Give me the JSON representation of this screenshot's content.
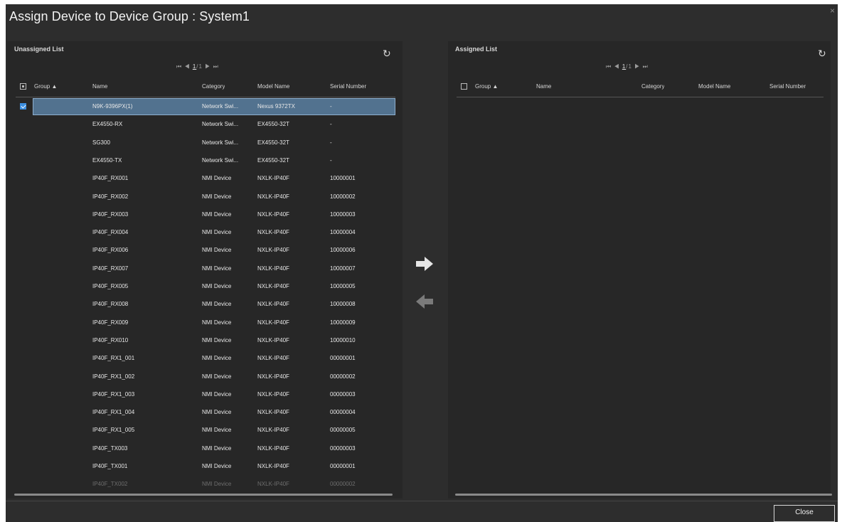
{
  "window": {
    "title": "Assign Device to Device Group : System1",
    "close_glyph": "×"
  },
  "unassigned": {
    "label": "Unassigned List",
    "refresh_icon": "↻",
    "pager": {
      "first": "⏮",
      "prev": "◀",
      "page": "1",
      "sep": "/",
      "total": "1",
      "next": "▶",
      "last": "⏭"
    },
    "headers": {
      "group": "Group",
      "sort_indicator": "▲",
      "name": "Name",
      "category": "Category",
      "model": "Model Name",
      "serial": "Serial Number"
    },
    "rows": [
      {
        "name": "N9K-9396PX(1)",
        "category": "Network Swi...",
        "model": "Nexus 9372TX",
        "serial": "-",
        "selected": true
      },
      {
        "name": "EX4550-RX",
        "category": "Network Swi...",
        "model": "EX4550-32T",
        "serial": "-"
      },
      {
        "name": "SG300",
        "category": "Network Swi...",
        "model": "EX4550-32T",
        "serial": "-"
      },
      {
        "name": "EX4550-TX",
        "category": "Network Swi...",
        "model": "EX4550-32T",
        "serial": "-"
      },
      {
        "name": "IP40F_RX001",
        "category": "NMI Device",
        "model": "NXLK-IP40F",
        "serial": "10000001"
      },
      {
        "name": "IP40F_RX002",
        "category": "NMI Device",
        "model": "NXLK-IP40F",
        "serial": "10000002"
      },
      {
        "name": "IP40F_RX003",
        "category": "NMI Device",
        "model": "NXLK-IP40F",
        "serial": "10000003"
      },
      {
        "name": "IP40F_RX004",
        "category": "NMI Device",
        "model": "NXLK-IP40F",
        "serial": "10000004"
      },
      {
        "name": "IP40F_RX006",
        "category": "NMI Device",
        "model": "NXLK-IP40F",
        "serial": "10000006"
      },
      {
        "name": "IP40F_RX007",
        "category": "NMI Device",
        "model": "NXLK-IP40F",
        "serial": "10000007"
      },
      {
        "name": "IP40F_RX005",
        "category": "NMI Device",
        "model": "NXLK-IP40F",
        "serial": "10000005"
      },
      {
        "name": "IP40F_RX008",
        "category": "NMI Device",
        "model": "NXLK-IP40F",
        "serial": "10000008"
      },
      {
        "name": "IP40F_RX009",
        "category": "NMI Device",
        "model": "NXLK-IP40F",
        "serial": "10000009"
      },
      {
        "name": "IP40F_RX010",
        "category": "NMI Device",
        "model": "NXLK-IP40F",
        "serial": "10000010"
      },
      {
        "name": "IP40F_RX1_001",
        "category": "NMI Device",
        "model": "NXLK-IP40F",
        "serial": "00000001"
      },
      {
        "name": "IP40F_RX1_002",
        "category": "NMI Device",
        "model": "NXLK-IP40F",
        "serial": "00000002"
      },
      {
        "name": "IP40F_RX1_003",
        "category": "NMI Device",
        "model": "NXLK-IP40F",
        "serial": "00000003"
      },
      {
        "name": "IP40F_RX1_004",
        "category": "NMI Device",
        "model": "NXLK-IP40F",
        "serial": "00000004"
      },
      {
        "name": "IP40F_RX1_005",
        "category": "NMI Device",
        "model": "NXLK-IP40F",
        "serial": "00000005"
      },
      {
        "name": "IP40F_TX003",
        "category": "NMI Device",
        "model": "NXLK-IP40F",
        "serial": "00000003"
      },
      {
        "name": "IP40F_TX001",
        "category": "NMI Device",
        "model": "NXLK-IP40F",
        "serial": "00000001"
      },
      {
        "name": "IP40F_TX002",
        "category": "NMI Device",
        "model": "NXLK-IP40F",
        "serial": "00000002",
        "faded": true
      }
    ]
  },
  "assigned": {
    "label": "Assigned List",
    "refresh_icon": "↻",
    "pager": {
      "first": "⏮",
      "prev": "◀",
      "page": "1",
      "sep": "/",
      "total": "1",
      "next": "▶",
      "last": "⏭"
    },
    "headers": {
      "group": "Group",
      "sort_indicator": "▲",
      "name": "Name",
      "category": "Category",
      "model": "Model Name",
      "serial": "Serial Number"
    },
    "rows": []
  },
  "actions": {
    "assign_icon": "arrow-right-icon",
    "unassign_icon": "arrow-left-icon",
    "close_label": "Close"
  },
  "colors": {
    "dialog_bg": "#2d2d2d",
    "panel_bg": "#272727",
    "selection": "#52728f",
    "checkbox_accent": "#3d8fe0"
  }
}
